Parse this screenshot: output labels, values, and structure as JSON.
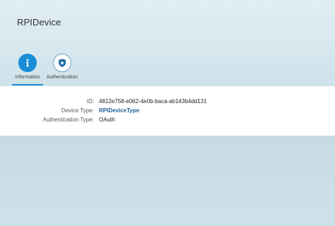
{
  "page": {
    "title": "RPIDevice"
  },
  "tabs": [
    {
      "label": "Information",
      "icon": "info-icon",
      "selected": true
    },
    {
      "label": "Authentication",
      "icon": "badge-icon",
      "selected": false
    }
  ],
  "details": {
    "id_label": "ID:",
    "id_value": "4812e758-e062-4e0b-baca-ab143b4dd131",
    "device_type_label": "Device Type:",
    "device_type_value": "RPIDeviceType",
    "auth_type_label": "Authentication Type:",
    "auth_type_value": "OAuth"
  },
  "colors": {
    "accent": "#1b8dd7",
    "link": "#1f5f99",
    "header_bg": "#dbeaf0",
    "content_bg": "#ffffff"
  }
}
